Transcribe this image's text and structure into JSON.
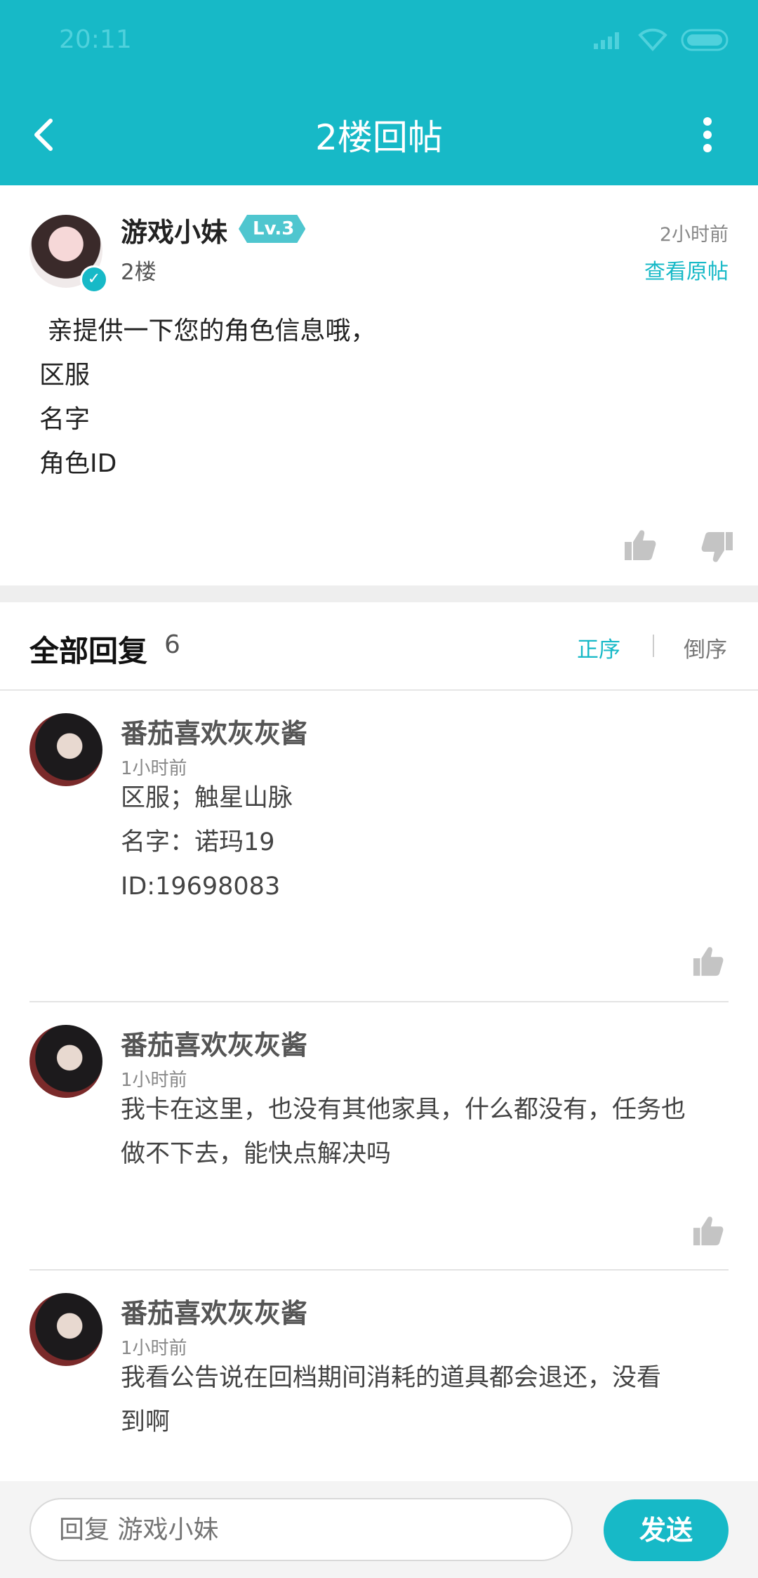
{
  "status_bar": {
    "time": "20:11"
  },
  "header": {
    "title": "2楼回帖"
  },
  "post": {
    "author": "游戏小妹",
    "level": "Lv.3",
    "floor": "2楼",
    "time": "2小时前",
    "view_original": "查看原帖",
    "content": [
      " 亲提供一下您的角色信息哦，",
      "区服",
      "名字",
      "角色ID"
    ]
  },
  "replies_header": {
    "title": "全部回复",
    "count": "6",
    "sort_asc": "正序",
    "sort_desc": "倒序"
  },
  "replies": [
    {
      "author": "番茄喜欢灰灰酱",
      "time": "1小时前",
      "content": [
        "区服；触星山脉",
        "名字：诺玛19",
        "ID:19698083"
      ]
    },
    {
      "author": "番茄喜欢灰灰酱",
      "time": "1小时前",
      "content": [
        "我卡在这里，也没有其他家具，什么都没有，任务也",
        "做不下去，能快点解决吗"
      ]
    },
    {
      "author": "番茄喜欢灰灰酱",
      "time": "1小时前",
      "content": [
        "我看公告说在回档期间消耗的道具都会退还，没看",
        "到啊"
      ]
    }
  ],
  "bottom_bar": {
    "input_placeholder": "回复 游戏小妹",
    "send_label": "发送"
  },
  "colors": {
    "accent": "#17b9c7"
  }
}
